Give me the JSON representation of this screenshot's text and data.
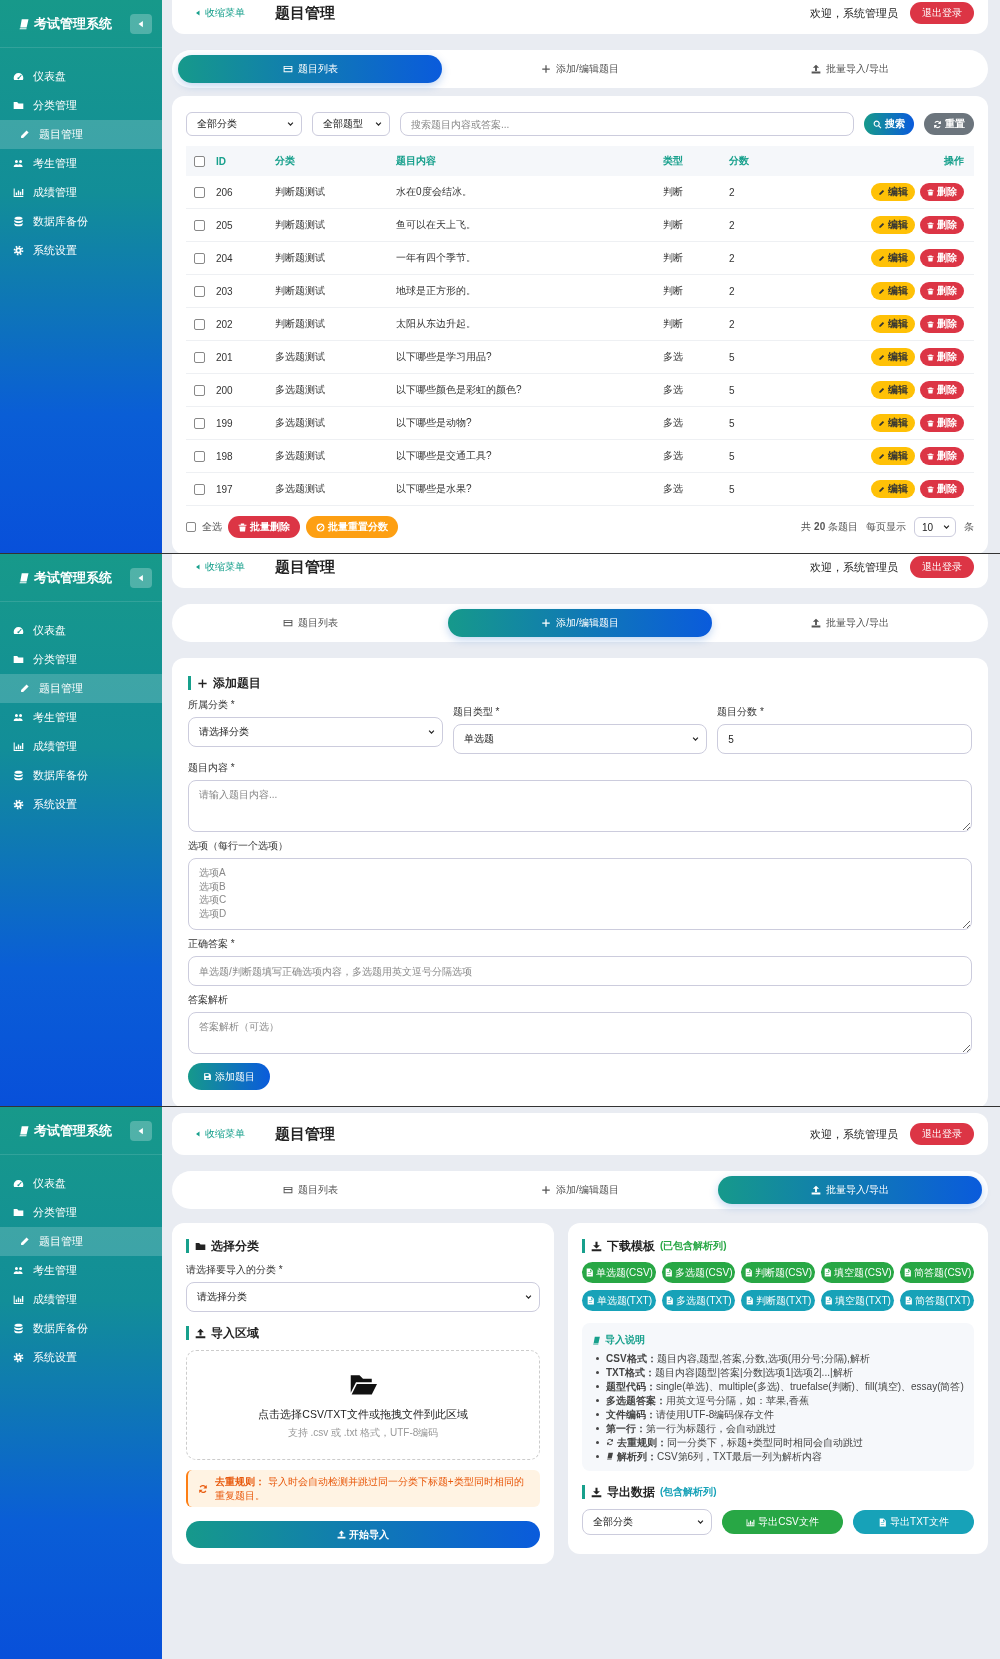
{
  "screens": [
    {
      "sidebar": {
        "title": "考试管理系统",
        "items": [
          {
            "label": "仪表盘",
            "selected": false
          },
          {
            "label": "分类管理",
            "selected": false
          },
          {
            "label": "题目管理",
            "selected": true
          },
          {
            "label": "考生管理",
            "selected": false
          },
          {
            "label": "成绩管理",
            "selected": false
          },
          {
            "label": "数据库备份",
            "selected": false
          },
          {
            "label": "系统设置",
            "selected": false
          }
        ]
      },
      "header": {
        "collapse": "收缩菜单",
        "title": "题目管理",
        "welcome": "欢迎，系统管理员",
        "logout": "退出登录"
      },
      "tabs": [
        {
          "label": "题目列表",
          "selected": true
        },
        {
          "label": "添加/编辑题目",
          "selected": false
        },
        {
          "label": "批量导入/导出",
          "selected": false
        }
      ],
      "content": {
        "kind": "list",
        "filters": {
          "category": "全部分类",
          "type": "全部题型",
          "search_placeholder": "搜索题目内容或答案...",
          "search_button": "搜索",
          "reset_button": "重置"
        },
        "table": {
          "header_checked": false,
          "columns": [
            "ID",
            "分类",
            "题目内容",
            "类型",
            "分数",
            "操作"
          ],
          "rows": [
            {
              "checked": false,
              "id": "206",
              "category": "判断题测试",
              "content": "水在0度会结冰。",
              "type": "判断",
              "score": "2",
              "edit": "编辑",
              "delete": "删除"
            },
            {
              "checked": false,
              "id": "205",
              "category": "判断题测试",
              "content": "鱼可以在天上飞。",
              "type": "判断",
              "score": "2",
              "edit": "编辑",
              "delete": "删除"
            },
            {
              "checked": false,
              "id": "204",
              "category": "判断题测试",
              "content": "一年有四个季节。",
              "type": "判断",
              "score": "2",
              "edit": "编辑",
              "delete": "删除"
            },
            {
              "checked": false,
              "id": "203",
              "category": "判断题测试",
              "content": "地球是正方形的。",
              "type": "判断",
              "score": "2",
              "edit": "编辑",
              "delete": "删除"
            },
            {
              "checked": false,
              "id": "202",
              "category": "判断题测试",
              "content": "太阳从东边升起。",
              "type": "判断",
              "score": "2",
              "edit": "编辑",
              "delete": "删除"
            },
            {
              "checked": false,
              "id": "201",
              "category": "多选题测试",
              "content": "以下哪些是学习用品?",
              "type": "多选",
              "score": "5",
              "edit": "编辑",
              "delete": "删除"
            },
            {
              "checked": false,
              "id": "200",
              "category": "多选题测试",
              "content": "以下哪些颜色是彩虹的颜色?",
              "type": "多选",
              "score": "5",
              "edit": "编辑",
              "delete": "删除"
            },
            {
              "checked": false,
              "id": "199",
              "category": "多选题测试",
              "content": "以下哪些是动物?",
              "type": "多选",
              "score": "5",
              "edit": "编辑",
              "delete": "删除"
            },
            {
              "checked": false,
              "id": "198",
              "category": "多选题测试",
              "content": "以下哪些是交通工具?",
              "type": "多选",
              "score": "5",
              "edit": "编辑",
              "delete": "删除"
            },
            {
              "checked": false,
              "id": "197",
              "category": "多选题测试",
              "content": "以下哪些是水果?",
              "type": "多选",
              "score": "5",
              "edit": "编辑",
              "delete": "删除"
            }
          ]
        },
        "footer": {
          "select_all": {
            "label": "全选",
            "checked": false
          },
          "batch_delete": "批量删除",
          "batch_reset": "批量重置分数",
          "total": "共 **20** 条题目",
          "per_page_label": "每页显示",
          "per_page": "10",
          "unit": "条"
        }
      }
    },
    {
      "sidebar": {
        "title": "考试管理系统",
        "items": [
          {
            "label": "仪表盘",
            "selected": false
          },
          {
            "label": "分类管理",
            "selected": false
          },
          {
            "label": "题目管理",
            "selected": true
          },
          {
            "label": "考生管理",
            "selected": false
          },
          {
            "label": "成绩管理",
            "selected": false
          },
          {
            "label": "数据库备份",
            "selected": false
          },
          {
            "label": "系统设置",
            "selected": false
          }
        ]
      },
      "header": {
        "collapse": "收缩菜单",
        "title": "题目管理",
        "welcome": "欢迎，系统管理员",
        "logout": "退出登录"
      },
      "tabs": [
        {
          "label": "题目列表",
          "selected": false
        },
        {
          "label": "添加/编辑题目",
          "selected": true
        },
        {
          "label": "批量导入/导出",
          "selected": false
        }
      ],
      "content": {
        "kind": "form",
        "title": "添加题目",
        "top_fields": [
          {
            "kind": "select",
            "label": "所属分类 *",
            "value": "请选择分类"
          },
          {
            "kind": "select",
            "label": "题目类型 *",
            "value": "单选题"
          },
          {
            "kind": "input",
            "label": "题目分数 *",
            "value": "5"
          }
        ],
        "fields": [
          {
            "kind": "textarea",
            "label": "题目内容 *",
            "placeholder": "请输入题目内容..."
          },
          {
            "kind": "textarea",
            "label": "选项（每行一个选项）",
            "placeholder": "选项A\n选项B\n选项C\n选项D"
          },
          {
            "kind": "input",
            "label": "正确答案 *",
            "placeholder": "单选题/判断题填写正确选项内容，多选题用英文逗号分隔选项"
          },
          {
            "kind": "textarea",
            "label": "答案解析",
            "placeholder": "答案解析（可选）"
          }
        ],
        "submit": "添加题目"
      }
    },
    {
      "sidebar": {
        "title": "考试管理系统",
        "items": [
          {
            "label": "仪表盘",
            "selected": false
          },
          {
            "label": "分类管理",
            "selected": false
          },
          {
            "label": "题目管理",
            "selected": true
          },
          {
            "label": "考生管理",
            "selected": false
          },
          {
            "label": "成绩管理",
            "selected": false
          },
          {
            "label": "数据库备份",
            "selected": false
          },
          {
            "label": "系统设置",
            "selected": false
          }
        ]
      },
      "header": {
        "collapse": "收缩菜单",
        "title": "题目管理",
        "welcome": "欢迎，系统管理员",
        "logout": "退出登录"
      },
      "tabs": [
        {
          "label": "题目列表",
          "selected": false
        },
        {
          "label": "添加/编辑题目",
          "selected": false
        },
        {
          "label": "批量导入/导出",
          "selected": true
        }
      ],
      "content": {
        "kind": "import",
        "select_section": {
          "title": "选择分类",
          "label": "请选择要导入的分类 *",
          "value": "请选择分类"
        },
        "upload_section": {
          "title": "导入区域",
          "prompt": "点击选择CSV/TXT文件或拖拽文件到此区域",
          "hint": "支持 .csv 或 .txt 格式，UTF-8编码"
        },
        "notice": "**去重规则：** 导入时会自动检测并跳过同一分类下标题+类型同时相同的重复题目。",
        "start_button": "开始导入",
        "templates": {
          "title": "下载模板",
          "note": "(已包含解析列)",
          "buttons": [
            {
              "label": "单选题(CSV)",
              "kind": "csv"
            },
            {
              "label": "多选题(CSV)",
              "kind": "csv"
            },
            {
              "label": "判断题(CSV)",
              "kind": "csv"
            },
            {
              "label": "填空题(CSV)",
              "kind": "csv"
            },
            {
              "label": "简答题(CSV)",
              "kind": "csv"
            },
            {
              "label": "单选题(TXT)",
              "kind": "txt"
            },
            {
              "label": "多选题(TXT)",
              "kind": "txt"
            },
            {
              "label": "判断题(TXT)",
              "kind": "txt"
            },
            {
              "label": "填空题(TXT)",
              "kind": "txt"
            },
            {
              "label": "简答题(TXT)",
              "kind": "txt"
            }
          ]
        },
        "help": {
          "title": "导入说明",
          "items": [
            {
              "kind": "text",
              "text": "**CSV格式：**题目内容,题型,答案,分数,选项(用分号;分隔),解析"
            },
            {
              "kind": "text",
              "text": "**TXT格式：**题目内容|题型|答案|分数|选项1|选项2|...|解析"
            },
            {
              "kind": "text",
              "text": "**题型代码：**single(单选)、multiple(多选)、truefalse(判断)、fill(填空)、essay(简答)"
            },
            {
              "kind": "text",
              "text": "**多选题答案：**用英文逗号分隔，如：苹果,香蕉"
            },
            {
              "kind": "text",
              "text": "**文件编码：**请使用UTF-8编码保存文件"
            },
            {
              "kind": "text",
              "text": "**第一行：**第一行为标题行，会自动跳过"
            },
            {
              "kind": "dedupe",
              "text": "**去重规则：**同一分类下，标题+类型同时相同会自动跳过"
            },
            {
              "kind": "analysis",
              "text": "**解析列：**CSV第6列，TXT最后一列为解析内容"
            }
          ]
        },
        "export": {
          "title": "导出数据",
          "note": "(包含解析列)",
          "category": "全部分类",
          "csv_button": "导出CSV文件",
          "txt_button": "导出TXT文件"
        }
      }
    }
  ]
}
